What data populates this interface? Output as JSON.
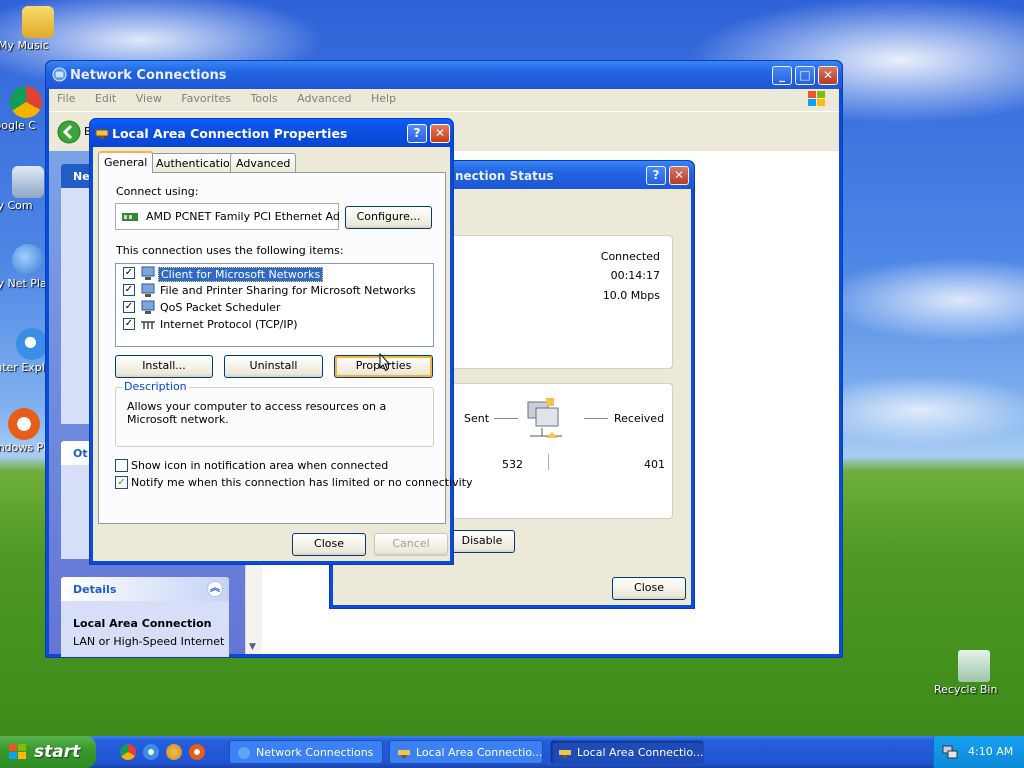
{
  "desktop": {
    "icons": [
      {
        "label": "My Music",
        "icon": "folder-music-icon"
      },
      {
        "label": "Google C",
        "icon": "chrome-icon"
      },
      {
        "label": "My Com",
        "icon": "my-computer-icon"
      },
      {
        "label": "My Net Plac",
        "icon": "my-network-places-icon"
      },
      {
        "label": "Inter Explo",
        "icon": "internet-explorer-icon"
      },
      {
        "label": "Windows Play",
        "icon": "media-player-icon"
      },
      {
        "label": "Recycle Bin",
        "icon": "recycle-bin-icon"
      }
    ]
  },
  "network_connections": {
    "title": "Network Connections",
    "menu": [
      "File",
      "Edit",
      "View",
      "Favorites",
      "Tools",
      "Advanced",
      "Help"
    ],
    "back_label": "B",
    "taskpane": {
      "network_tasks_header": "Ne",
      "other_places_header": "Ot",
      "details_header": "Details",
      "details_name": "Local Area Connection",
      "details_type": "LAN or High-Speed Internet"
    }
  },
  "status_window": {
    "title": "nection Status",
    "status": "Connected",
    "duration": "00:14:17",
    "speed": "10.0 Mbps",
    "sent_label": "Sent",
    "received_label": "Received",
    "sent_value": "532",
    "received_value": "401",
    "disable_label": "Disable",
    "close_label": "Close"
  },
  "properties_dialog": {
    "title": "Local Area Connection Properties",
    "tabs": [
      "General",
      "Authentication",
      "Advanced"
    ],
    "connect_using_label": "Connect using:",
    "adapter": "AMD PCNET Family PCI Ethernet Ad",
    "configure_label": "Configure...",
    "items_label": "This connection uses the following items:",
    "items": [
      {
        "label": "Client for Microsoft Networks",
        "checked": true,
        "selected": true
      },
      {
        "label": "File and Printer Sharing for Microsoft Networks",
        "checked": true,
        "selected": false
      },
      {
        "label": "QoS Packet Scheduler",
        "checked": true,
        "selected": false
      },
      {
        "label": "Internet Protocol (TCP/IP)",
        "checked": true,
        "selected": false
      }
    ],
    "install_label": "Install...",
    "uninstall_label": "Uninstall",
    "properties_label": "Properties",
    "description_title": "Description",
    "description_text": "Allows your computer to access resources on a Microsoft network.",
    "show_icon_label": "Show icon in notification area when connected",
    "show_icon_checked": false,
    "notify_label": "Notify me when this connection has limited or no connectivity",
    "notify_checked": true,
    "close_label": "Close",
    "cancel_label": "Cancel",
    "help_glyph": "?",
    "close_glyph": "✕"
  },
  "taskbar": {
    "start_label": "start",
    "tasks": [
      {
        "label": "Network Connections",
        "active": false
      },
      {
        "label": "Local Area Connectio...",
        "active": false
      },
      {
        "label": "Local Area Connectio...",
        "active": true
      }
    ],
    "clock": "4:10 AM"
  }
}
